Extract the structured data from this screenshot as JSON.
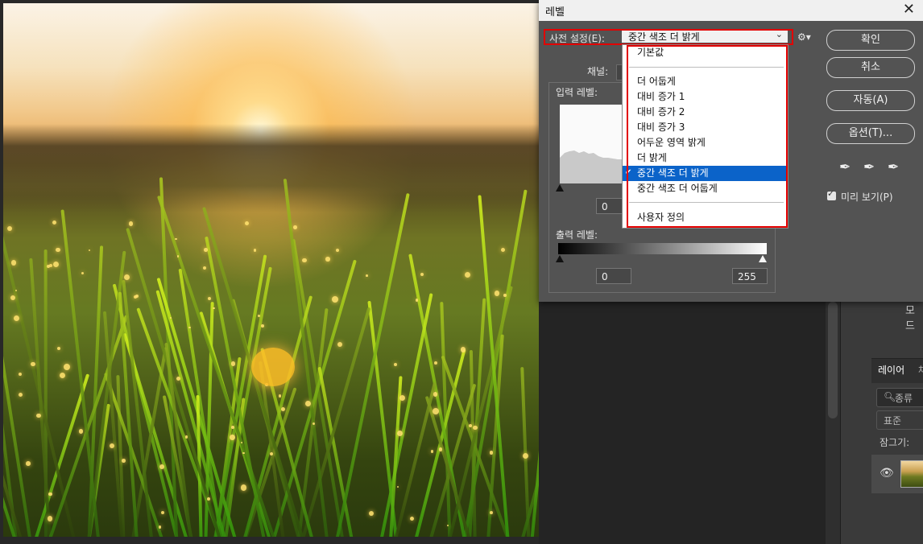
{
  "dialog": {
    "title": "레벨",
    "close": "✕",
    "preset_label": "사전 설정(E):",
    "preset_value": "중간 색조 더 밝게",
    "channel_label": "채널:",
    "input_levels_label": "입력 레벨:",
    "output_levels_label": "출력 레벨:",
    "input_shadow": "0",
    "output_shadow": "0",
    "output_highlight": "255",
    "buttons": {
      "ok": "확인",
      "cancel": "취소",
      "auto": "자동(A)",
      "options": "옵션(T)..."
    },
    "preview_label": "미리 보기(P)",
    "preview_checked": true
  },
  "dropdown": {
    "items": [
      "기본값",
      "더 어둡게",
      "대비 증가 1",
      "대비 증가 2",
      "대비 증가 3",
      "어두운 영역 밝게",
      "더 밝게",
      "중간 색조 더 밝게",
      "중간 색조 더 어둡게",
      "사용자 정의"
    ],
    "selected": "중간 색조 더 밝게"
  },
  "layers_panel": {
    "mode_label": "모드",
    "tab_layers": "레이어",
    "tab_other": "채",
    "search_placeholder": "종류",
    "blend_mode": "표준",
    "lock_label": "잠그기:"
  },
  "colors": {
    "dialog_bg": "#535353",
    "highlight": "#0b63c9",
    "annotation": "#e30000"
  }
}
